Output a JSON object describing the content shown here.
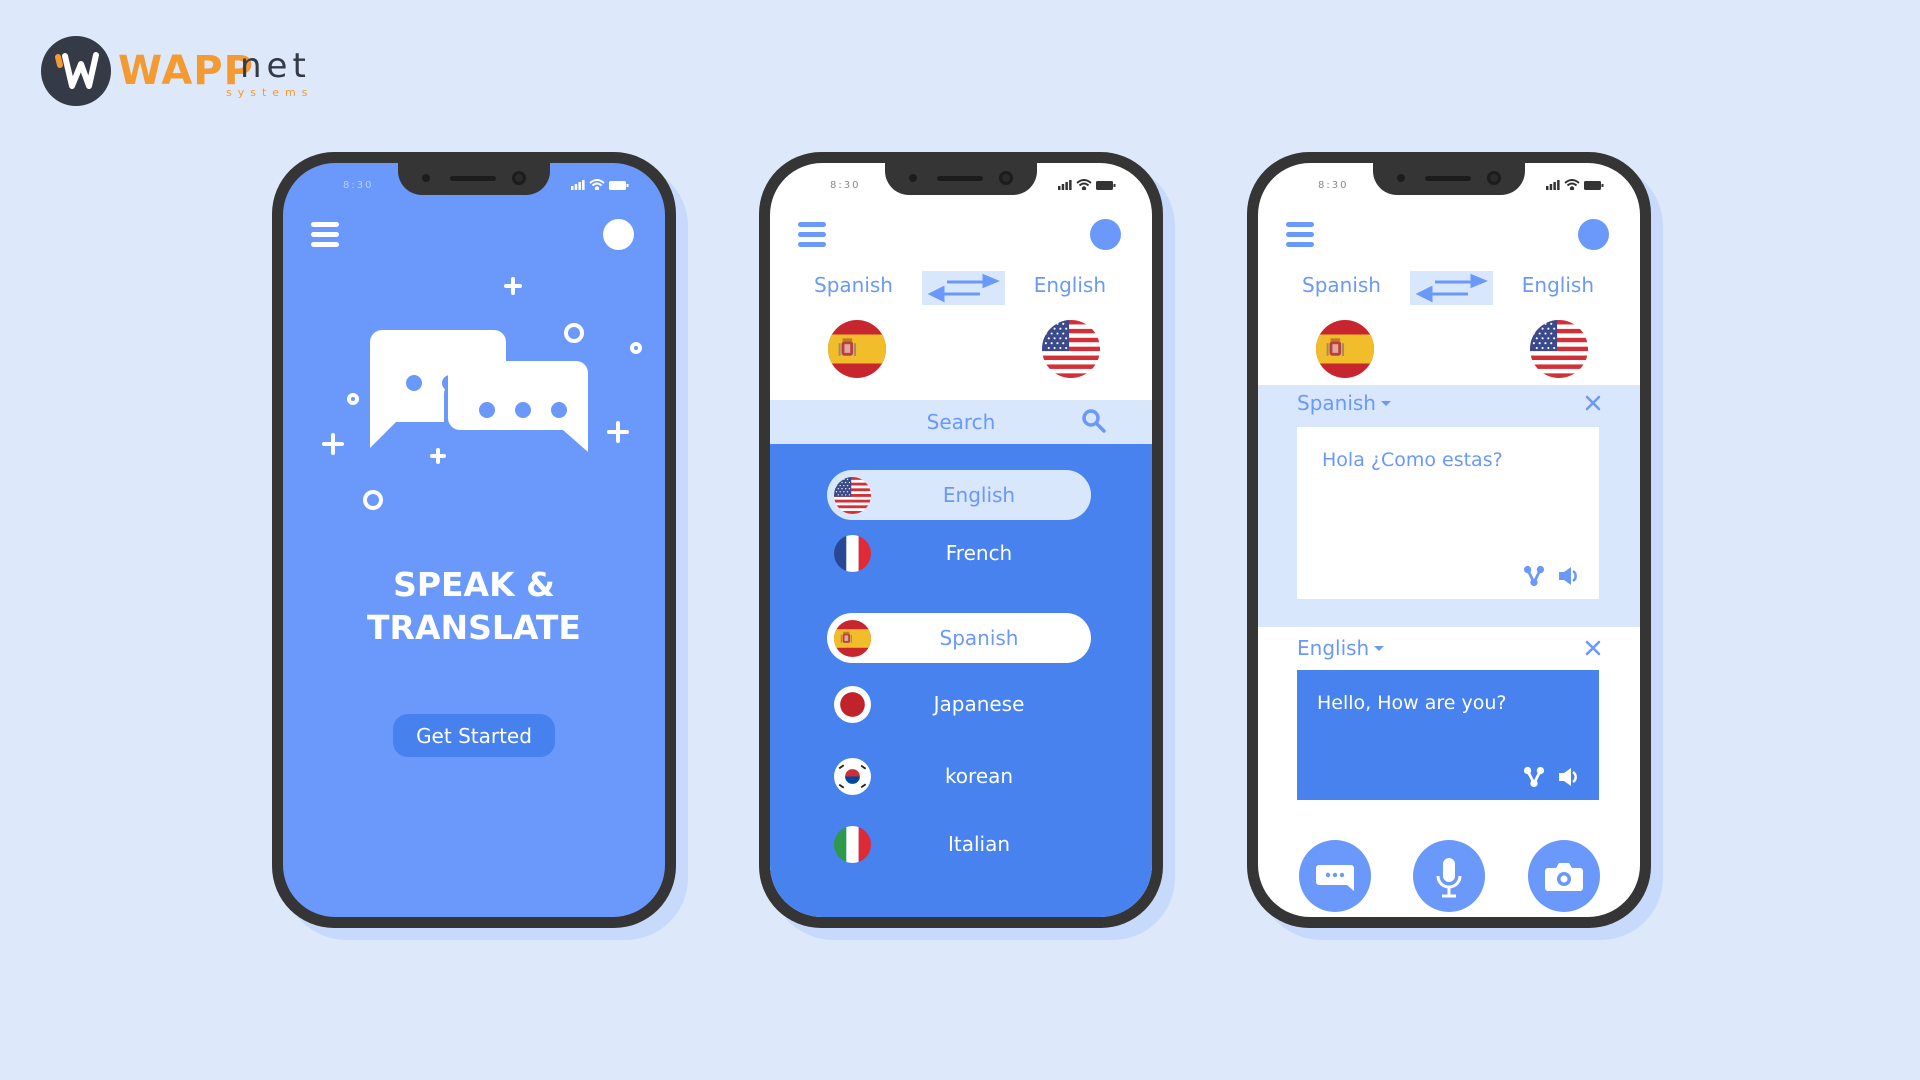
{
  "brand": {
    "name_main": "WAPP",
    "name_suffix": "net",
    "tagline": "systems",
    "colors": {
      "orange": "#f39a32",
      "dark": "#343a46"
    }
  },
  "colors": {
    "background": "#dde9fb",
    "primary_blue": "#6a98fb",
    "deep_blue": "#4782ee",
    "light_blue": "#d9e7fd",
    "frame": "#353535"
  },
  "phones": {
    "splash": {
      "time": "8:30",
      "title_line1": "SPEAK &",
      "title_line2": "TRANSLATE",
      "cta_label": "Get Started"
    },
    "language_picker": {
      "time": "8:30",
      "from_lang": "Spanish",
      "to_lang": "English",
      "search_placeholder": "Search",
      "languages": [
        {
          "label": "English",
          "flag": "us-flag-icon",
          "state": "highlighted"
        },
        {
          "label": "French",
          "flag": "france-flag-icon",
          "state": "normal"
        },
        {
          "label": "Spanish",
          "flag": "spain-flag-icon",
          "state": "selected"
        },
        {
          "label": "Japanese",
          "flag": "japan-flag-icon",
          "state": "normal"
        },
        {
          "label": "korean",
          "flag": "korea-flag-icon",
          "state": "normal"
        },
        {
          "label": "Italian",
          "flag": "italy-flag-icon",
          "state": "normal"
        }
      ]
    },
    "translator": {
      "time": "8:30",
      "from_lang": "Spanish",
      "to_lang": "English",
      "source_lang": "Spanish",
      "source_text": "Hola ¿Como estas?",
      "target_lang": "English",
      "target_text": "Hello, How are you?",
      "actions": [
        "chat-icon",
        "microphone-icon",
        "camera-icon"
      ]
    }
  }
}
